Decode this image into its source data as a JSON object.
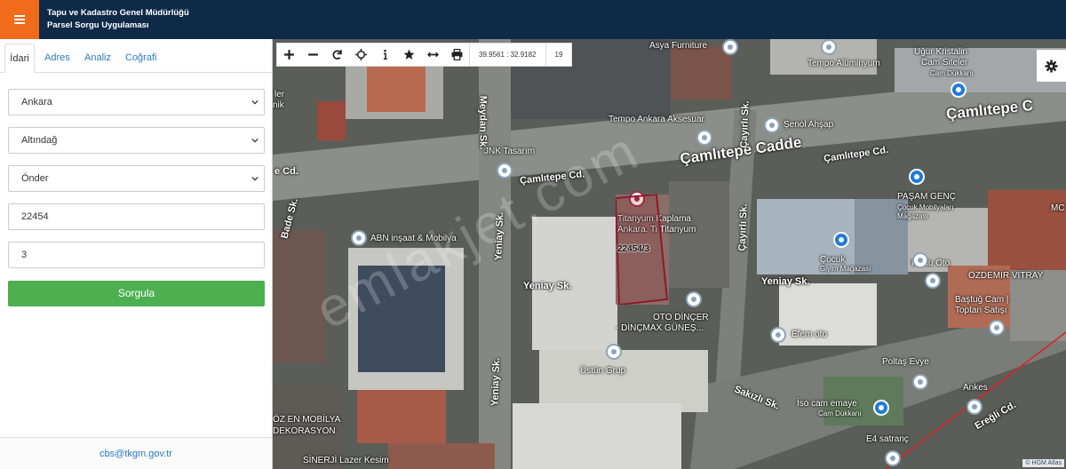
{
  "header": {
    "title_line1": "Tapu ve Kadastro Genel Müdürlüğü",
    "title_line2": "Parsel Sorgu Uygulaması"
  },
  "tabs": [
    {
      "label": "İdari"
    },
    {
      "label": "Adres"
    },
    {
      "label": "Analiz"
    },
    {
      "label": "Coğrafi"
    }
  ],
  "form": {
    "il": "Ankara",
    "ilce": "Altındağ",
    "mahalle": "Önder",
    "ada": "22454",
    "parsel": "3",
    "submit_label": "Sorgula"
  },
  "footer": {
    "email": "cbs@tkgm.gov.tr"
  },
  "map": {
    "coordinates": "39.9561 : 32.9182",
    "zoom_level": "19",
    "parcel_label": "22454/3",
    "attribution": "© HGM Atlas",
    "watermark": "emlakjet.com",
    "labels": {
      "asya": "Asya Furniture",
      "tempo_alum": "Tempo Alüminyum",
      "ugur1": "Uğur Kristalin",
      "ugur2": "Cam Siteler",
      "ugur3": "Cam Dükkanı",
      "camlitepe_cadde": "Çamlıtepe Cadde",
      "camlitepe_c_right": "Çamlıtepe C",
      "tempo_ankara": "Tempo Ankara Aksesuar",
      "senol": "Şenol Ahşap",
      "camlitepe_cd2": "Çamlıtepe Cd.",
      "camlitepe_cd1": "Çamlıtepe Cd.",
      "jnk": "JNK Tasarım",
      "meydan": "Meydan Sk.",
      "cayirli1": "Çayırlı Sk.",
      "cayirli2": "Çayırlı Sk.",
      "e_cd": "e Cd.",
      "bade": "Bade Sk.",
      "titanyum1": "Titanyum Kaplama",
      "titanyum2": "Ankara. Ti Titanyum",
      "pasam1": "PAŞAM GENÇ",
      "pasam2": "Çocuk Mobilyaları",
      "pasam3": "Mağazası",
      "abn": "ABN inşaat & Mobilya",
      "yeniay1": "Yeniay Sk.",
      "yeniay2": "Yeniay Sk.",
      "yeniay3": "Yeniay Sk.",
      "yeniay4": "Yeniay Sk.",
      "cocuk1": "Çocuk",
      "cocuk2": "Giyim Mağazası",
      "mutlu": "Mutlu Oto",
      "ozdemir": "ÖZDEMİR VİTRAY",
      "bastug1": "Baştuğ Cam |",
      "bastug2": "Toptan Satışı",
      "oto1": "OTO DİNÇER",
      "oto2": "- DİNÇMAX GÜNEŞ...",
      "efem": "Efem oto",
      "ustun": "Üstün Grup",
      "poltas": "Poltaş Evye",
      "sakizli": "Sakızlı Sk.",
      "iso1": "İso cam emaye",
      "iso2": "Cam Dükkanı",
      "ankes": "Ankes",
      "ozen1": "ÖZ EN MOBİLYA",
      "ozen2": "DEKORASYON",
      "sinerji": "SİNERJİ Lazer Kesim",
      "e4": "E4 satranç",
      "eregli": "Ereğli Cd.",
      "mc": "MC",
      "ler": "ler",
      "nik": "nik"
    }
  },
  "colors": {
    "header_bg": "#0e2a47",
    "menu_accent": "#f26b1d",
    "submit_green": "#4caf50",
    "link_blue": "#2a7bc4",
    "parcel_outline": "#8b1a2b"
  }
}
